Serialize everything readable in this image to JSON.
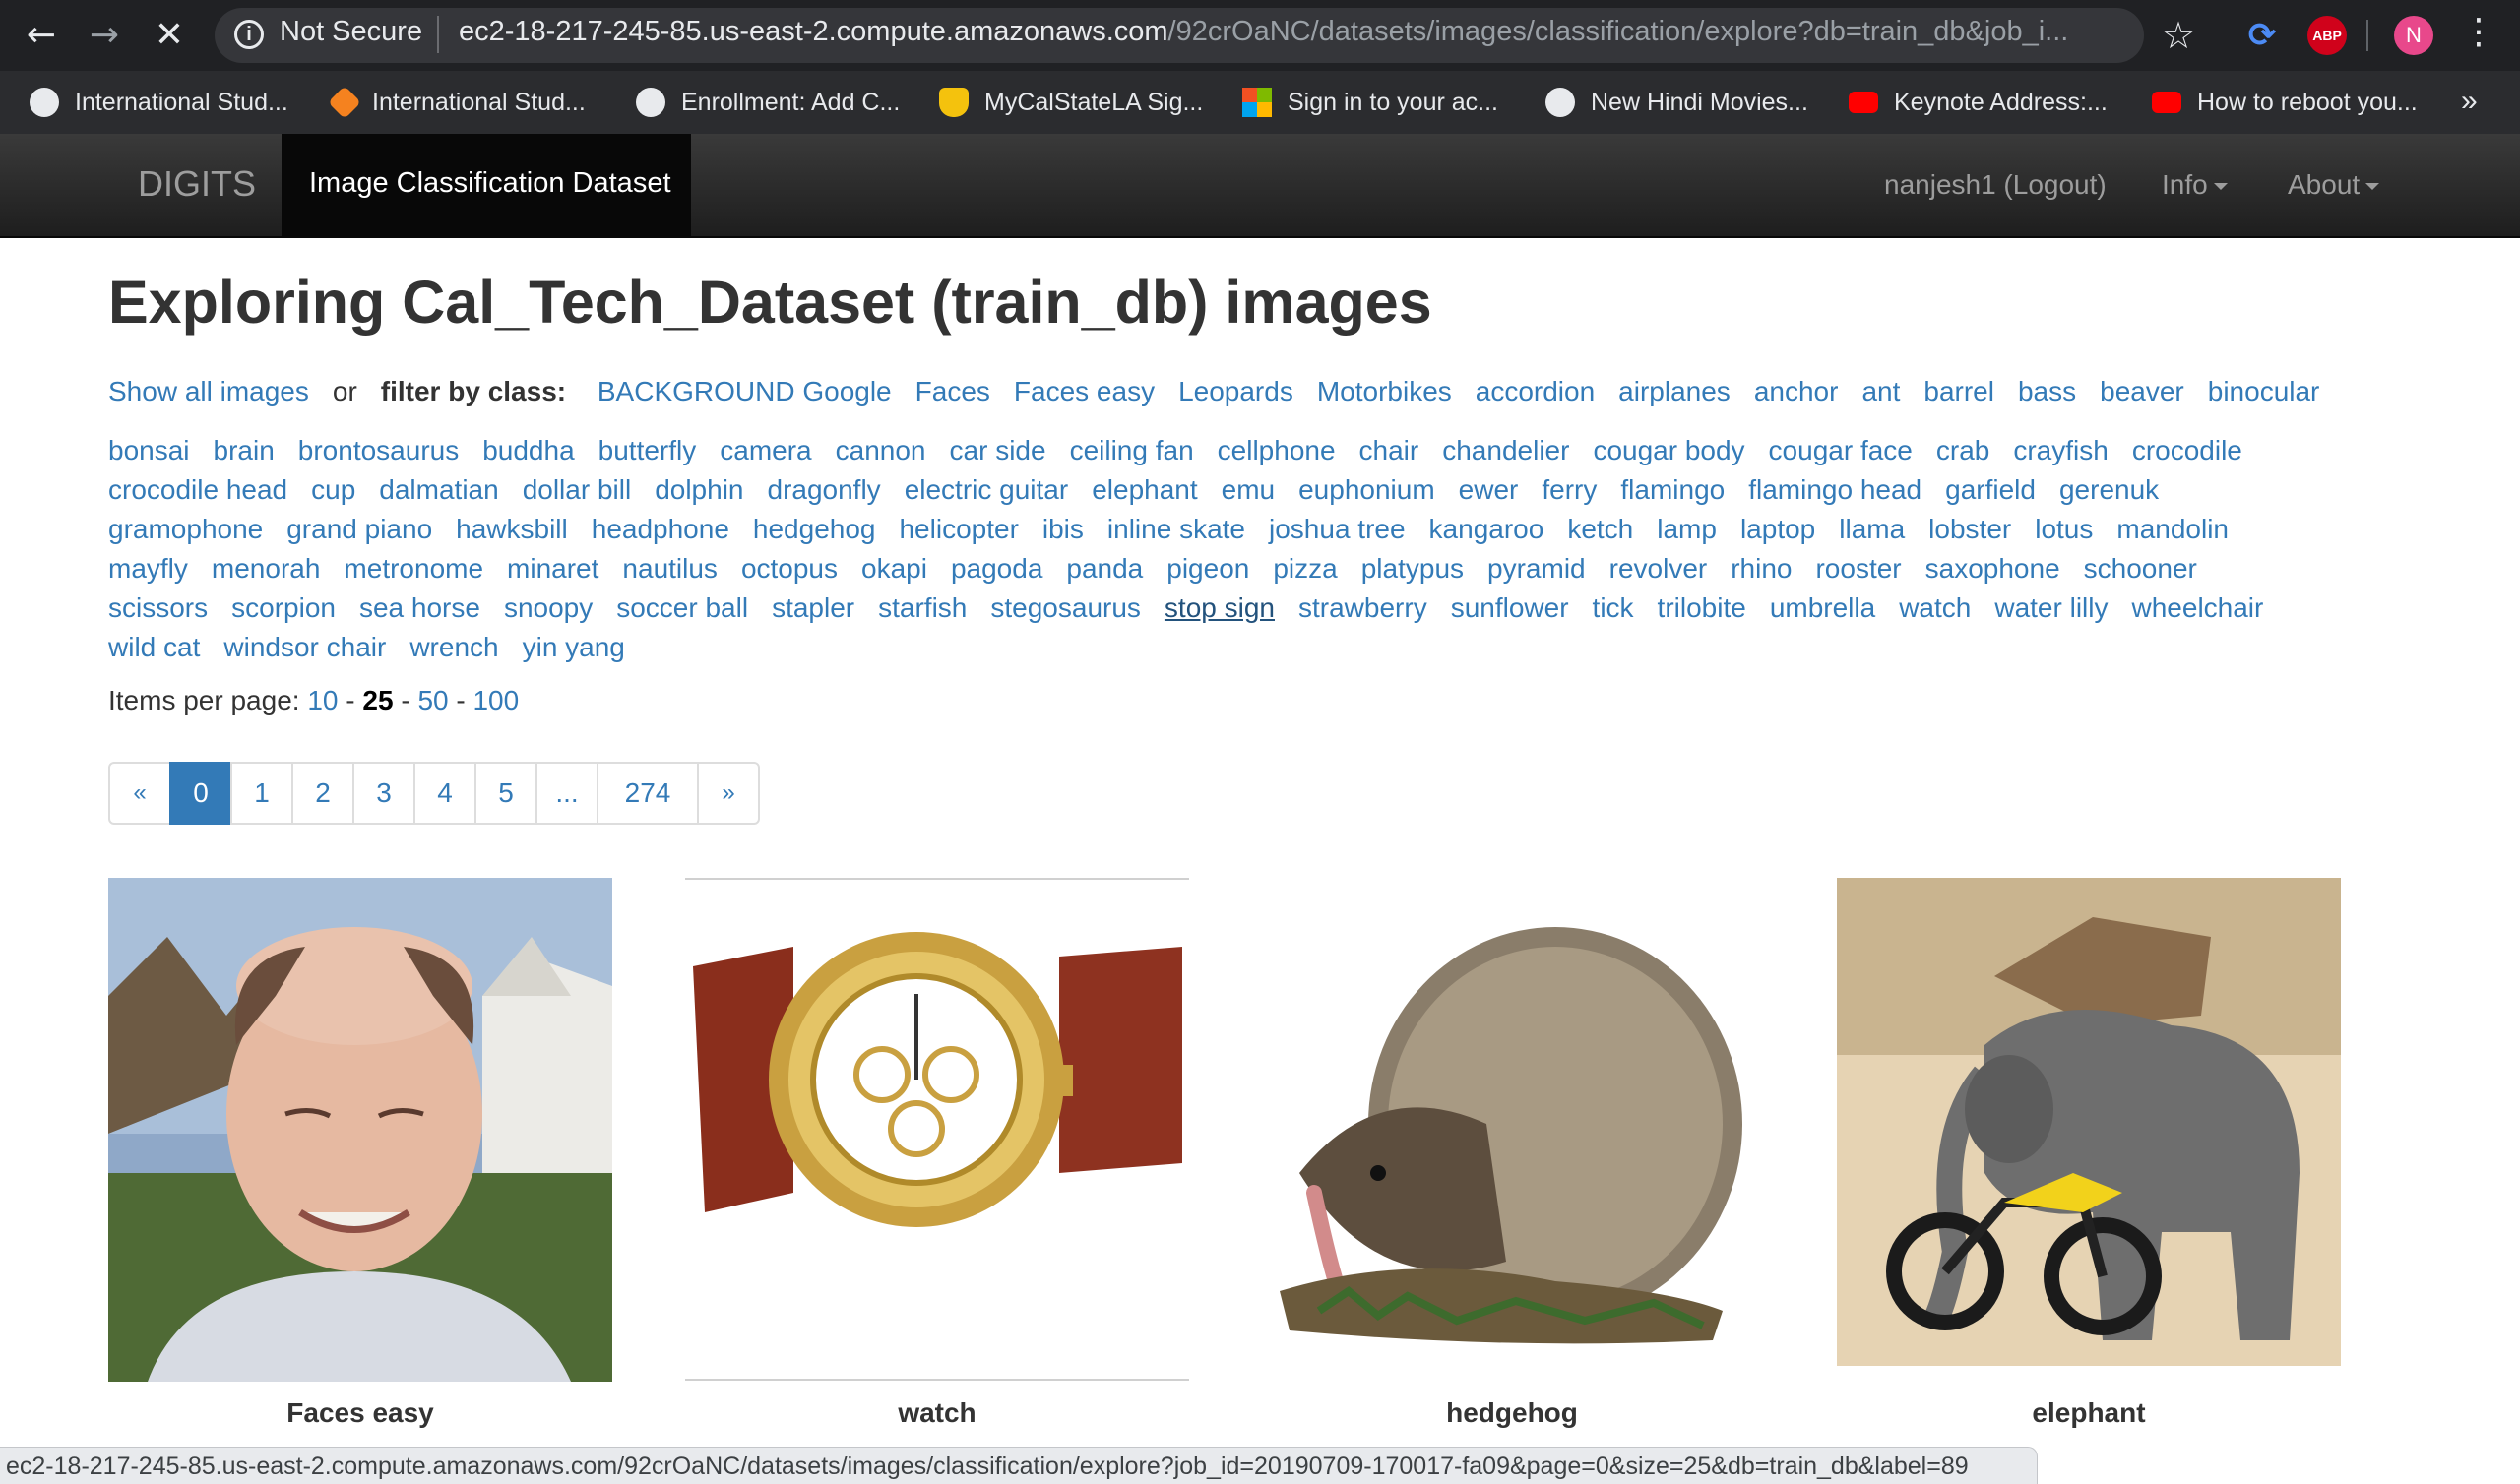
{
  "browser": {
    "security_label": "Not Secure",
    "url_host": "ec2-18-217-245-85.us-east-2.compute.amazonaws.com",
    "url_path": "/92crOaNC/datasets/images/classification/explore?db=train_db&job_i...",
    "avatar_letter": "N",
    "abp_label": "ABP",
    "status_url": "ec2-18-217-245-85.us-east-2.compute.amazonaws.com/92crOaNC/datasets/images/classification/explore?job_id=20190709-170017-fa09&page=0&size=25&db=train_db&label=89"
  },
  "bookmarks": [
    {
      "label": "International Stud...",
      "icon": "globe-icon",
      "color": "#e8eaed"
    },
    {
      "label": "International Stud...",
      "icon": "orange-swirl-icon",
      "color": "#f5821f"
    },
    {
      "label": "Enrollment: Add C...",
      "icon": "globe-icon",
      "color": "#e8eaed"
    },
    {
      "label": "MyCalStateLA Sig...",
      "icon": "shield-icon",
      "color": "#f4c20d"
    },
    {
      "label": "Sign in to your ac...",
      "icon": "microsoft-icon",
      "color": "#7fba00"
    },
    {
      "label": "New Hindi Movies...",
      "icon": "globe-icon",
      "color": "#e8eaed"
    },
    {
      "label": "Keynote Address:...",
      "icon": "youtube-icon",
      "color": "#ff0000"
    },
    {
      "label": "How to reboot you...",
      "icon": "youtube-icon",
      "color": "#ff0000"
    }
  ],
  "navbar": {
    "brand": "DIGITS",
    "active_tab": "Image Classification Dataset",
    "user": "nanjesh1 (Logout)",
    "info": "Info",
    "about": "About"
  },
  "page": {
    "title": "Exploring Cal_Tech_Dataset (train_db) images",
    "show_all": "Show all images",
    "or_label": "or",
    "filter_label": "filter by class:",
    "hovered_class": "stop sign",
    "class_rows": [
      [
        "BACKGROUND Google",
        "Faces",
        "Faces easy",
        "Leopards",
        "Motorbikes",
        "accordion",
        "airplanes",
        "anchor",
        "ant",
        "barrel",
        "bass",
        "beaver",
        "binocular"
      ],
      [
        "bonsai",
        "brain",
        "brontosaurus",
        "buddha",
        "butterfly",
        "camera",
        "cannon",
        "car side",
        "ceiling fan",
        "cellphone",
        "chair",
        "chandelier",
        "cougar body",
        "cougar face",
        "crab",
        "crayfish",
        "crocodile"
      ],
      [
        "crocodile head",
        "cup",
        "dalmatian",
        "dollar bill",
        "dolphin",
        "dragonfly",
        "electric guitar",
        "elephant",
        "emu",
        "euphonium",
        "ewer",
        "ferry",
        "flamingo",
        "flamingo head",
        "garfield",
        "gerenuk"
      ],
      [
        "gramophone",
        "grand piano",
        "hawksbill",
        "headphone",
        "hedgehog",
        "helicopter",
        "ibis",
        "inline skate",
        "joshua tree",
        "kangaroo",
        "ketch",
        "lamp",
        "laptop",
        "llama",
        "lobster",
        "lotus",
        "mandolin"
      ],
      [
        "mayfly",
        "menorah",
        "metronome",
        "minaret",
        "nautilus",
        "octopus",
        "okapi",
        "pagoda",
        "panda",
        "pigeon",
        "pizza",
        "platypus",
        "pyramid",
        "revolver",
        "rhino",
        "rooster",
        "saxophone",
        "schooner"
      ],
      [
        "scissors",
        "scorpion",
        "sea horse",
        "snoopy",
        "soccer ball",
        "stapler",
        "starfish",
        "stegosaurus",
        "stop sign",
        "strawberry",
        "sunflower",
        "tick",
        "trilobite",
        "umbrella",
        "watch",
        "water lilly",
        "wheelchair"
      ],
      [
        "wild cat",
        "windsor chair",
        "wrench",
        "yin yang"
      ]
    ],
    "items_per_page_label": "Items per page:",
    "ipp_options": [
      "10",
      "25",
      "50",
      "100"
    ],
    "ipp_selected": "25",
    "sep": "-",
    "pagination": {
      "prev": "«",
      "pages": [
        "0",
        "1",
        "2",
        "3",
        "4",
        "5",
        "...",
        "274"
      ],
      "active": "0",
      "next": "»"
    },
    "thumbnails": [
      {
        "caption": "Faces easy"
      },
      {
        "caption": "watch"
      },
      {
        "caption": "hedgehog"
      },
      {
        "caption": "elephant"
      }
    ]
  }
}
